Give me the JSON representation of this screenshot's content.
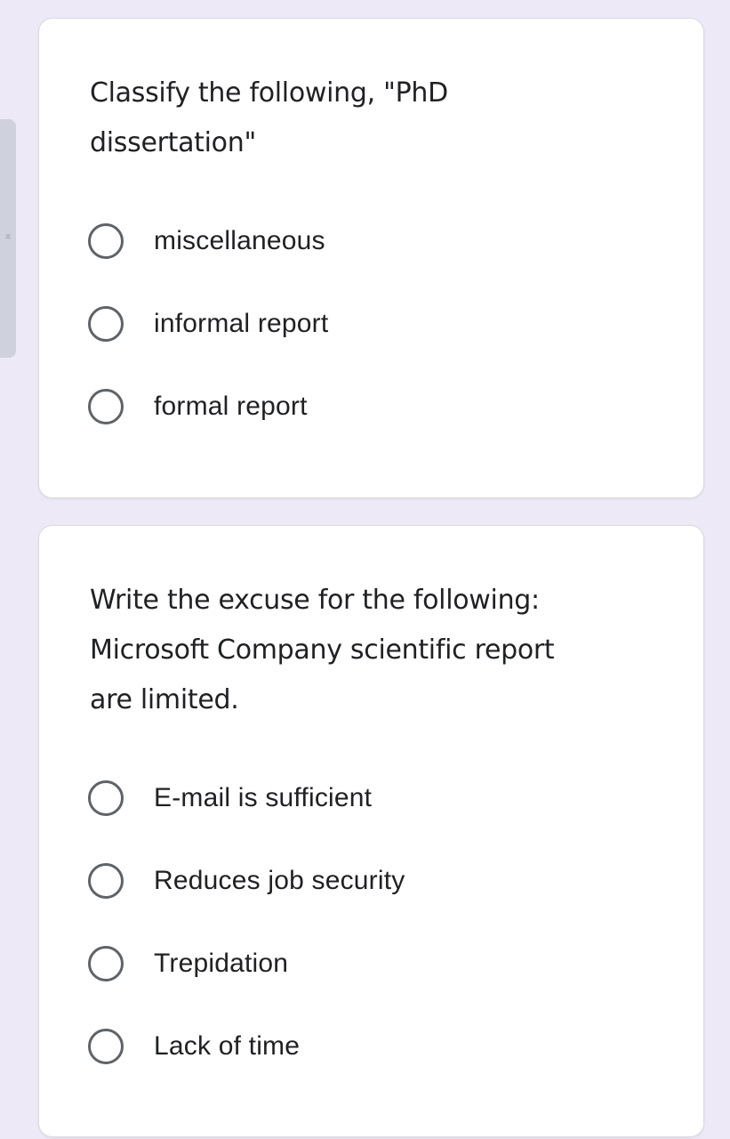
{
  "side_panel": {
    "icon": "list-icon"
  },
  "questions": [
    {
      "title": "Classify the following, \"PhD dissertation\"",
      "title_lines": [
        "Classify the following, \"PhD",
        "dissertation\""
      ],
      "options": [
        {
          "label": "miscellaneous",
          "selected": false
        },
        {
          "label": "informal report",
          "selected": false
        },
        {
          "label": "formal report",
          "selected": false
        }
      ]
    },
    {
      "title": "Write the excuse for the following: Microsoft Company scientific report are limited.",
      "title_lines": [
        "Write the excuse for the following:",
        "Microsoft Company scientific report",
        "are limited."
      ],
      "options": [
        {
          "label": "E-mail is sufficient",
          "selected": false
        },
        {
          "label": "Reduces job security",
          "selected": false
        },
        {
          "label": "Trepidation",
          "selected": false
        },
        {
          "label": "Lack of time",
          "selected": false
        }
      ]
    }
  ],
  "colors": {
    "background": "#ede9f6",
    "card": "#ffffff",
    "radio_border": "#5f6368",
    "text": "#202124"
  }
}
